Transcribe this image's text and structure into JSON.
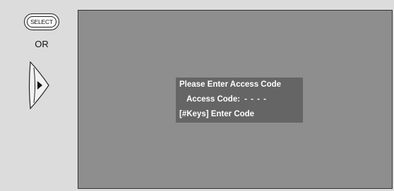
{
  "remote": {
    "select_label": "SELECT",
    "or_label": "OR",
    "dpad_icon": "dpad-right-arrow-icon"
  },
  "dialog": {
    "title": "Please Enter Access Code",
    "code_label": "Access Code:",
    "code_value": "- - - -",
    "hint": "[#Keys] Enter Code"
  },
  "colors": {
    "background": "#dcdcdc",
    "screen": "#8e8e8e",
    "dialog": "#656565",
    "dialog_text": "#ffffff"
  }
}
